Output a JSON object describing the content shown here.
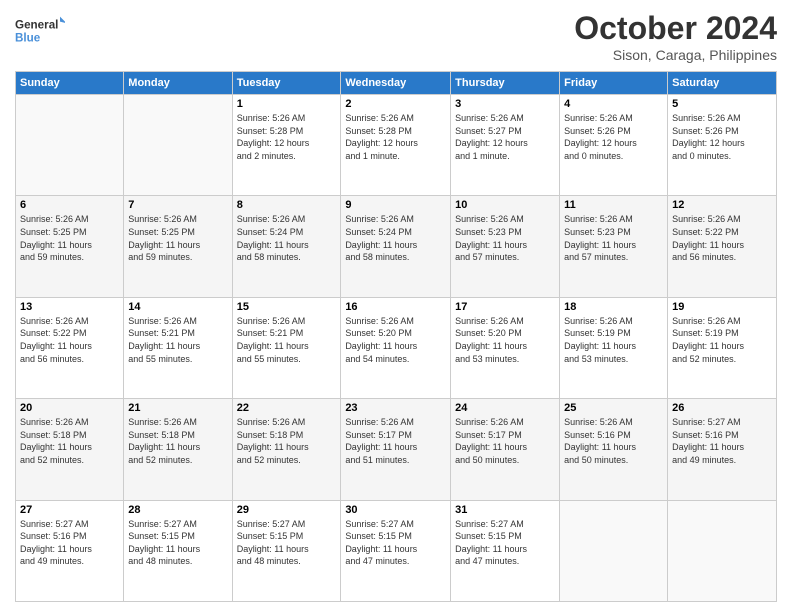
{
  "logo": {
    "line1": "General",
    "line2": "Blue"
  },
  "title": "October 2024",
  "subtitle": "Sison, Caraga, Philippines",
  "days_header": [
    "Sunday",
    "Monday",
    "Tuesday",
    "Wednesday",
    "Thursday",
    "Friday",
    "Saturday"
  ],
  "weeks": [
    [
      {
        "day": "",
        "info": ""
      },
      {
        "day": "",
        "info": ""
      },
      {
        "day": "1",
        "info": "Sunrise: 5:26 AM\nSunset: 5:28 PM\nDaylight: 12 hours\nand 2 minutes."
      },
      {
        "day": "2",
        "info": "Sunrise: 5:26 AM\nSunset: 5:28 PM\nDaylight: 12 hours\nand 1 minute."
      },
      {
        "day": "3",
        "info": "Sunrise: 5:26 AM\nSunset: 5:27 PM\nDaylight: 12 hours\nand 1 minute."
      },
      {
        "day": "4",
        "info": "Sunrise: 5:26 AM\nSunset: 5:26 PM\nDaylight: 12 hours\nand 0 minutes."
      },
      {
        "day": "5",
        "info": "Sunrise: 5:26 AM\nSunset: 5:26 PM\nDaylight: 12 hours\nand 0 minutes."
      }
    ],
    [
      {
        "day": "6",
        "info": "Sunrise: 5:26 AM\nSunset: 5:25 PM\nDaylight: 11 hours\nand 59 minutes."
      },
      {
        "day": "7",
        "info": "Sunrise: 5:26 AM\nSunset: 5:25 PM\nDaylight: 11 hours\nand 59 minutes."
      },
      {
        "day": "8",
        "info": "Sunrise: 5:26 AM\nSunset: 5:24 PM\nDaylight: 11 hours\nand 58 minutes."
      },
      {
        "day": "9",
        "info": "Sunrise: 5:26 AM\nSunset: 5:24 PM\nDaylight: 11 hours\nand 58 minutes."
      },
      {
        "day": "10",
        "info": "Sunrise: 5:26 AM\nSunset: 5:23 PM\nDaylight: 11 hours\nand 57 minutes."
      },
      {
        "day": "11",
        "info": "Sunrise: 5:26 AM\nSunset: 5:23 PM\nDaylight: 11 hours\nand 57 minutes."
      },
      {
        "day": "12",
        "info": "Sunrise: 5:26 AM\nSunset: 5:22 PM\nDaylight: 11 hours\nand 56 minutes."
      }
    ],
    [
      {
        "day": "13",
        "info": "Sunrise: 5:26 AM\nSunset: 5:22 PM\nDaylight: 11 hours\nand 56 minutes."
      },
      {
        "day": "14",
        "info": "Sunrise: 5:26 AM\nSunset: 5:21 PM\nDaylight: 11 hours\nand 55 minutes."
      },
      {
        "day": "15",
        "info": "Sunrise: 5:26 AM\nSunset: 5:21 PM\nDaylight: 11 hours\nand 55 minutes."
      },
      {
        "day": "16",
        "info": "Sunrise: 5:26 AM\nSunset: 5:20 PM\nDaylight: 11 hours\nand 54 minutes."
      },
      {
        "day": "17",
        "info": "Sunrise: 5:26 AM\nSunset: 5:20 PM\nDaylight: 11 hours\nand 53 minutes."
      },
      {
        "day": "18",
        "info": "Sunrise: 5:26 AM\nSunset: 5:19 PM\nDaylight: 11 hours\nand 53 minutes."
      },
      {
        "day": "19",
        "info": "Sunrise: 5:26 AM\nSunset: 5:19 PM\nDaylight: 11 hours\nand 52 minutes."
      }
    ],
    [
      {
        "day": "20",
        "info": "Sunrise: 5:26 AM\nSunset: 5:18 PM\nDaylight: 11 hours\nand 52 minutes."
      },
      {
        "day": "21",
        "info": "Sunrise: 5:26 AM\nSunset: 5:18 PM\nDaylight: 11 hours\nand 52 minutes."
      },
      {
        "day": "22",
        "info": "Sunrise: 5:26 AM\nSunset: 5:18 PM\nDaylight: 11 hours\nand 52 minutes."
      },
      {
        "day": "23",
        "info": "Sunrise: 5:26 AM\nSunset: 5:17 PM\nDaylight: 11 hours\nand 51 minutes."
      },
      {
        "day": "24",
        "info": "Sunrise: 5:26 AM\nSunset: 5:17 PM\nDaylight: 11 hours\nand 50 minutes."
      },
      {
        "day": "25",
        "info": "Sunrise: 5:26 AM\nSunset: 5:16 PM\nDaylight: 11 hours\nand 50 minutes."
      },
      {
        "day": "26",
        "info": "Sunrise: 5:27 AM\nSunset: 5:16 PM\nDaylight: 11 hours\nand 49 minutes."
      }
    ],
    [
      {
        "day": "27",
        "info": "Sunrise: 5:27 AM\nSunset: 5:16 PM\nDaylight: 11 hours\nand 49 minutes."
      },
      {
        "day": "28",
        "info": "Sunrise: 5:27 AM\nSunset: 5:15 PM\nDaylight: 11 hours\nand 48 minutes."
      },
      {
        "day": "29",
        "info": "Sunrise: 5:27 AM\nSunset: 5:15 PM\nDaylight: 11 hours\nand 48 minutes."
      },
      {
        "day": "30",
        "info": "Sunrise: 5:27 AM\nSunset: 5:15 PM\nDaylight: 11 hours\nand 47 minutes."
      },
      {
        "day": "31",
        "info": "Sunrise: 5:27 AM\nSunset: 5:15 PM\nDaylight: 11 hours\nand 47 minutes."
      },
      {
        "day": "",
        "info": ""
      },
      {
        "day": "",
        "info": ""
      }
    ]
  ]
}
